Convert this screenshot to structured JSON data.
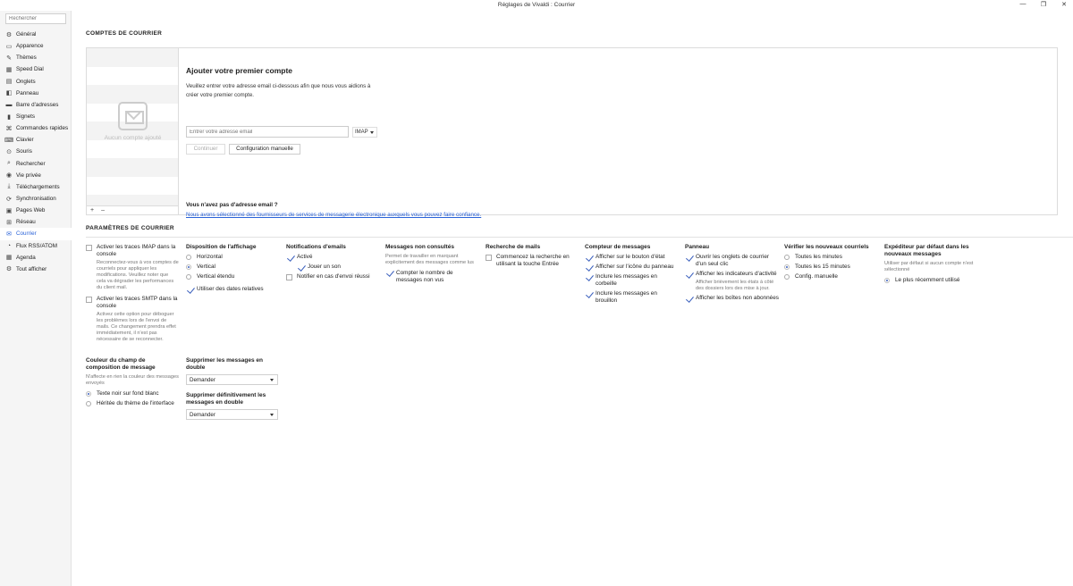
{
  "window": {
    "title": "Réglages de Vivaldi : Courrier",
    "controls": {
      "minimize": "—",
      "restore": "❐",
      "close": "✕"
    }
  },
  "sidebar": {
    "search_placeholder": "Rechercher",
    "active": "Courrier",
    "items": [
      {
        "label": "Général",
        "icon": "gear-icon",
        "glyph": "⚙"
      },
      {
        "label": "Apparence",
        "icon": "window-icon",
        "glyph": "▭"
      },
      {
        "label": "Thèmes",
        "icon": "palette-icon",
        "glyph": "✎"
      },
      {
        "label": "Speed Dial",
        "icon": "grid-icon",
        "glyph": "▦"
      },
      {
        "label": "Onglets",
        "icon": "tabs-icon",
        "glyph": "▤"
      },
      {
        "label": "Panneau",
        "icon": "panel-icon",
        "glyph": "◧"
      },
      {
        "label": "Barre d'adresses",
        "icon": "address-bar-icon",
        "glyph": "▬"
      },
      {
        "label": "Signets",
        "icon": "bookmark-icon",
        "glyph": "▮"
      },
      {
        "label": "Commandes rapides",
        "icon": "quick-command-icon",
        "glyph": "⌘"
      },
      {
        "label": "Clavier",
        "icon": "keyboard-icon",
        "glyph": "⌨"
      },
      {
        "label": "Souris",
        "icon": "mouse-icon",
        "glyph": "⊙"
      },
      {
        "label": "Rechercher",
        "icon": "search-icon",
        "glyph": "⌕"
      },
      {
        "label": "Vie privée",
        "icon": "eye-icon",
        "glyph": "◉"
      },
      {
        "label": "Téléchargements",
        "icon": "download-icon",
        "glyph": "⤓"
      },
      {
        "label": "Synchronisation",
        "icon": "sync-icon",
        "glyph": "⟳"
      },
      {
        "label": "Pages Web",
        "icon": "web-page-icon",
        "glyph": "▣"
      },
      {
        "label": "Réseau",
        "icon": "network-icon",
        "glyph": "⊞"
      },
      {
        "label": "Courrier",
        "icon": "mail-icon",
        "glyph": "✉"
      },
      {
        "label": "Flux RSS/ATOM",
        "icon": "rss-icon",
        "glyph": "◔"
      },
      {
        "label": "Agenda",
        "icon": "calendar-icon",
        "glyph": "▦"
      },
      {
        "label": "Tout afficher",
        "icon": "settings-all-icon",
        "glyph": "⚙"
      }
    ]
  },
  "accounts": {
    "section_title": "COMPTES DE COURRIER",
    "empty_text": "Aucun compte ajouté",
    "add_symbol": "+",
    "remove_symbol": "–",
    "form_title": "Ajouter votre premier compte",
    "form_desc": "Veuillez entrer votre adresse email ci-dessous afin que nous vous aidions à créer votre premier compte.",
    "email_placeholder": "Entrer votre adresse email",
    "protocol": "IMAP",
    "continue_label": "Continuer",
    "manual_label": "Configuration manuelle",
    "no_address_q": "Vous n'avez pas d'adresse email ?",
    "providers_link": "Nous avons sélectionné des fournisseurs de services de messagerie électronique auxquels vous pouvez faire confiance."
  },
  "settings": {
    "section_title": "PARAMÈTRES DE COURRIER",
    "logging": {
      "imap_label": "Activer les traces IMAP dans la console",
      "imap_help": "Reconnectez-vous à vos comptes de courriels pour appliquer les modifications. Veuillez noter que cela va dégrader les performances du client mail.",
      "smtp_label": "Activer les traces SMTP dans la console",
      "smtp_help": "Activez cette option pour déboguer les problèmes lors de l'envoi de mails. Ce changement prendra effet immédiatement, il n'est pas nécessaire de se reconnecter."
    },
    "display": {
      "title": "Disposition de l'affichage",
      "horizontal": "Horizontal",
      "vertical": "Vertical",
      "vertical_extended": "Vertical étendu",
      "relative_dates": "Utiliser des dates relatives"
    },
    "notifications": {
      "title": "Notifications d'emails",
      "enabled": "Activé",
      "play_sound": "Jouer un son",
      "notify_sent": "Notifier en cas d'envoi réussi"
    },
    "unread": {
      "title": "Messages non consultés",
      "help": "Permet de travailler en marquant explicitement des messages comme lus",
      "count_unseen": "Compter le nombre de messages non vus"
    },
    "mail_search": {
      "title": "Recherche de mails",
      "enter_search": "Commencez la recherche en utilisant la touche Entrée"
    },
    "counter": {
      "title": "Compteur de messages",
      "status_button": "Afficher sur le bouton d'état",
      "panel_icon": "Afficher sur l'icône du panneau",
      "include_trash": "Inclure les messages en corbeille",
      "include_drafts": "Inclure les messages en brouillon"
    },
    "panel": {
      "title": "Panneau",
      "open_tabs": "Ouvrir les onglets de courrier d'un seul clic",
      "activity": "Afficher les indicateurs d'activité",
      "activity_help": "Afficher brièvement les états à côté des dossiers lors des mise à jour.",
      "unsubscribed": "Afficher les boîtes non abonnées"
    },
    "check": {
      "title": "Vérifier les nouveaux courriels",
      "every_minute": "Toutes les minutes",
      "every_15": "Toutes les 15 minutes",
      "manual": "Config. manuelle"
    },
    "sender": {
      "title": "Expéditeur par défaut dans les nouveaux messages",
      "help": "Utiliser par défaut si aucun compte n'est sélectionné",
      "recent": "Le plus récemment utilisé"
    },
    "compose_color": {
      "title": "Couleur du champ de composition de message",
      "help": "N'affecte en rien la couleur des messages envoyés",
      "black_on_white": "Texte noir sur fond blanc",
      "inherit_theme": "Héritée du thème de l'interface"
    },
    "duplicates": {
      "delete_title": "Supprimer les messages en double",
      "delete_value": "Demander",
      "perm_title": "Supprimer définitivement les messages en double",
      "perm_value": "Demander"
    }
  }
}
